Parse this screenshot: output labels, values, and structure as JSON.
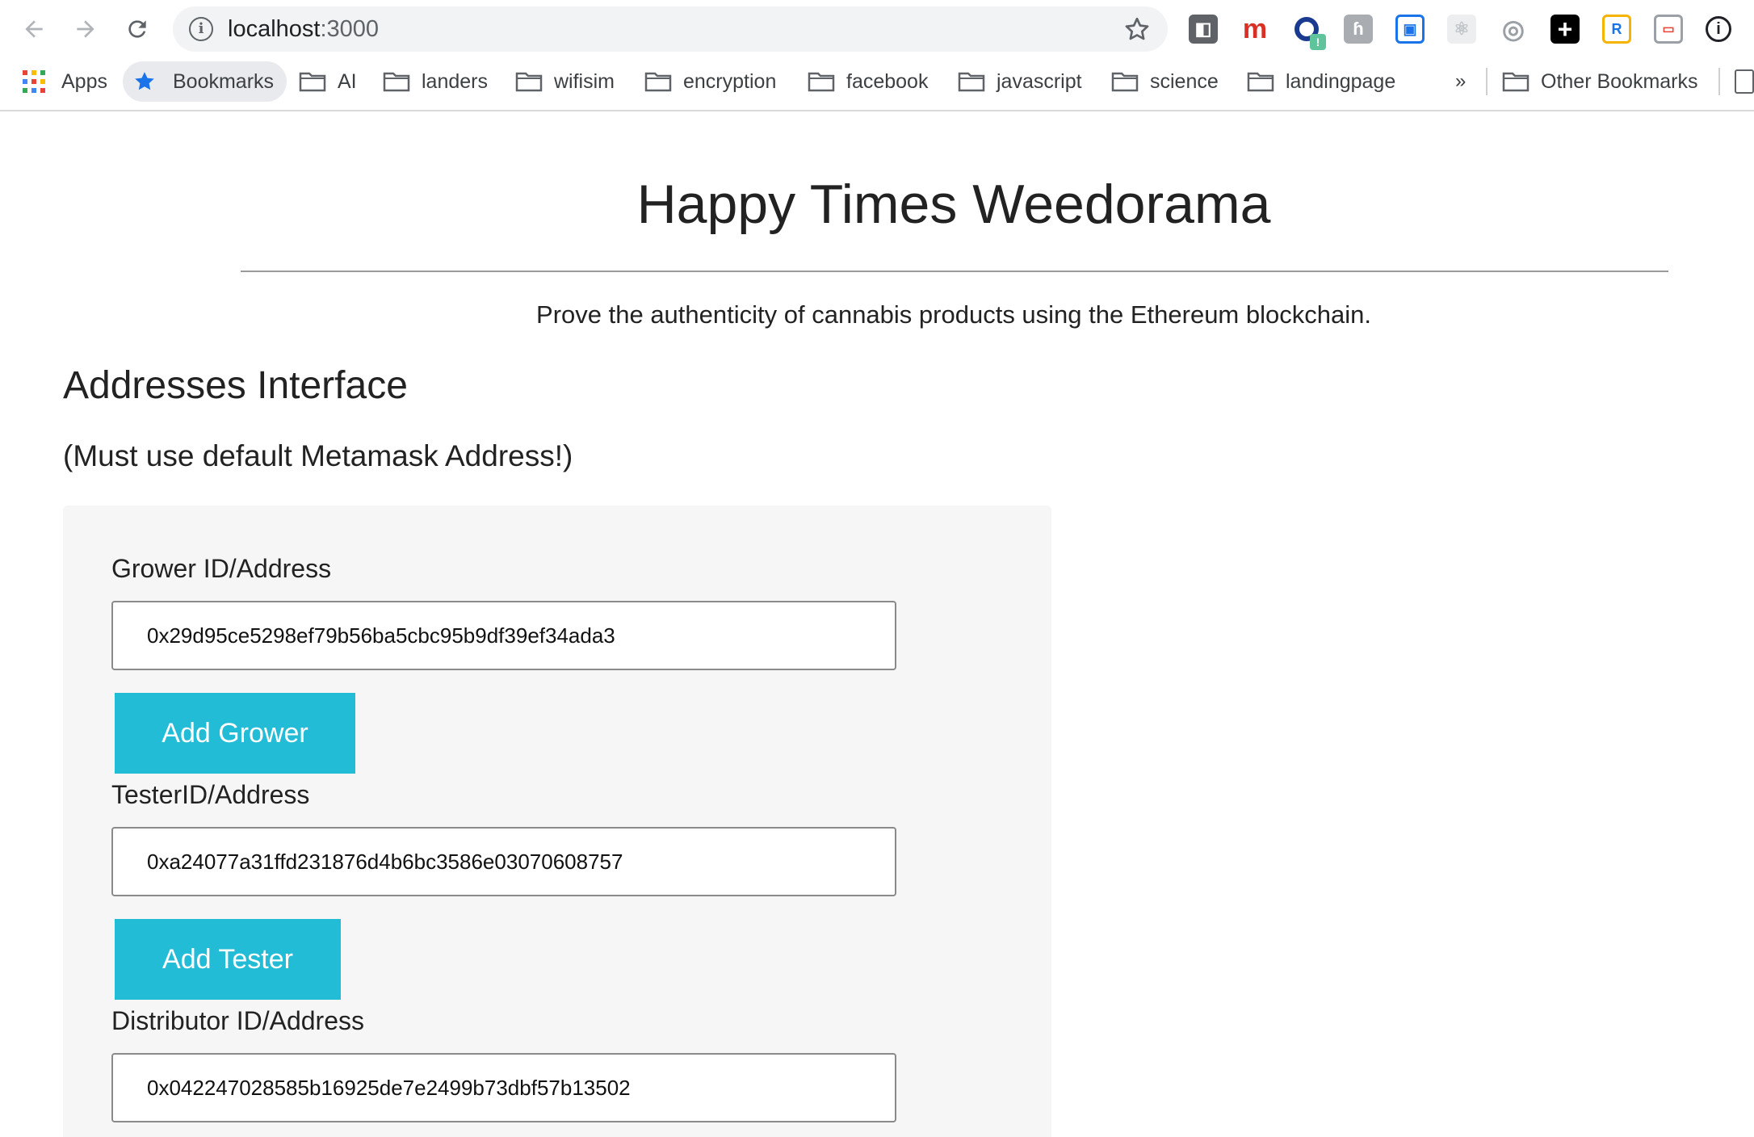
{
  "browser": {
    "url_host": "localhost",
    "url_port": ":3000",
    "extensions": [
      {
        "name": "screencast",
        "glyph": "◧",
        "color": "#5f6368"
      },
      {
        "name": "m",
        "glyph": "m",
        "color": "#d93025"
      },
      {
        "name": "ring",
        "glyph": "◯",
        "color": "#1a3a8f"
      },
      {
        "name": "hook",
        "glyph": "ɦ",
        "color": "#9aa0a6"
      },
      {
        "name": "reader",
        "glyph": "▣",
        "color": "#1a73e8"
      },
      {
        "name": "react",
        "glyph": "⚛",
        "color": "#c0c4c8"
      },
      {
        "name": "target",
        "glyph": "◎",
        "color": "#9aa0a6"
      },
      {
        "name": "plus",
        "glyph": "+",
        "color": "#ffffff"
      },
      {
        "name": "r-logo",
        "glyph": "R",
        "color": "#1a73e8"
      },
      {
        "name": "cast",
        "glyph": "▭",
        "color": "#ea4335"
      },
      {
        "name": "info",
        "glyph": "ⓘ",
        "color": "#202124"
      }
    ]
  },
  "bookmarks": {
    "apps": "Apps",
    "bookmarks": "Bookmarks",
    "folders": [
      "AI",
      "landers",
      "wifisim",
      "encryption",
      "facebook",
      "javascript",
      "science",
      "landingpage"
    ],
    "overflow": "»",
    "other": "Other Bookmarks"
  },
  "page": {
    "title": "Happy Times Weedorama",
    "lead": "Prove the authenticity of cannabis products using the Ethereum blockchain.",
    "section_title": "Addresses Interface",
    "section_subtitle": "(Must use default Metamask Address!)"
  },
  "form": {
    "grower_label": "Grower ID/Address",
    "grower_value": "0x29d95ce5298ef79b56ba5cbc95b9df39ef34ada3",
    "add_grower": "Add Grower",
    "tester_label": "TesterID/Address",
    "tester_value": "0xa24077a31ffd231876d4b6bc3586e03070608757",
    "add_tester": "Add Tester",
    "distributor_label": "Distributor ID/Address",
    "distributor_value": "0x042247028585b16925de7e2499b73dbf57b13502"
  },
  "colors": {
    "button": "#23bcd6",
    "panel": "#f6f6f6"
  }
}
